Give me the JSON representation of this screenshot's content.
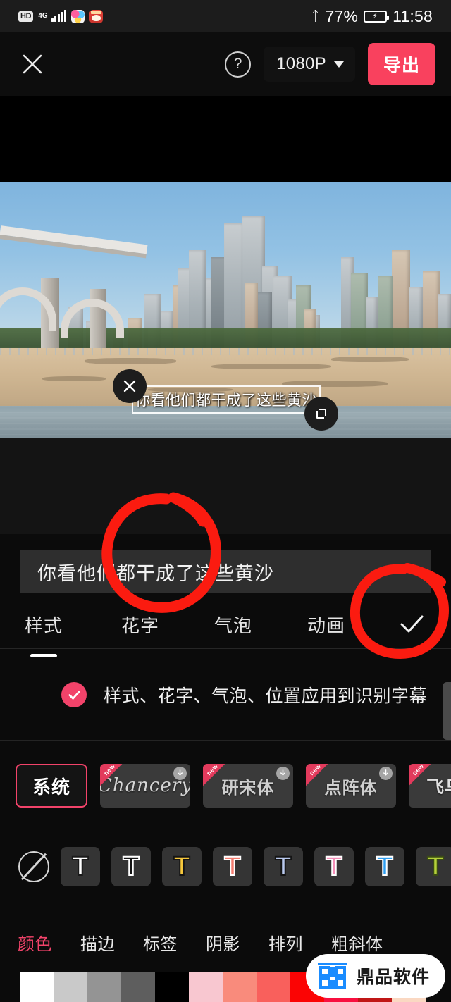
{
  "status_bar": {
    "hd_badge": "HD",
    "network": "4G",
    "bluetooth_icon": "bluetooth-icon",
    "battery_percent": "77%",
    "battery_icon": "battery-charging-icon",
    "time": "11:58",
    "app_icons": [
      "photos-app-icon",
      "red-app-icon"
    ]
  },
  "toolbar": {
    "close_icon": "close-icon",
    "help_icon": "help-question-icon",
    "resolution": "1080P",
    "resolution_caret": "chevron-down-icon",
    "export_label": "导出"
  },
  "preview": {
    "caption_text": "你看他们都干成了这些黄沙",
    "delete_icon": "close-icon",
    "resize_icon": "resize-handle-icon"
  },
  "editor": {
    "input_value": "你看他们都干成了这些黄沙",
    "tabs": [
      {
        "label": "样式",
        "active": true
      },
      {
        "label": "花字",
        "active": false
      },
      {
        "label": "气泡",
        "active": false
      },
      {
        "label": "动画",
        "active": false
      }
    ],
    "confirm_icon": "checkmark-icon",
    "apply": {
      "checked": true,
      "check_icon": "check-icon",
      "label": "样式、花字、气泡、位置应用到识别字幕",
      "accent_color": "#f2436a"
    },
    "fonts": [
      {
        "label": "系统",
        "selected": true,
        "new": false,
        "download": false,
        "style": "system"
      },
      {
        "label": "Chancery",
        "selected": false,
        "new": true,
        "download": true,
        "style": "script",
        "badge": "new"
      },
      {
        "label": "研宋体",
        "selected": false,
        "new": true,
        "download": true,
        "style": "serif",
        "badge": "new"
      },
      {
        "label": "点阵体",
        "selected": false,
        "new": true,
        "download": true,
        "style": "serif",
        "badge": "new"
      },
      {
        "label": "飞乌集",
        "selected": false,
        "new": true,
        "download": false,
        "style": "calli",
        "badge": "new"
      }
    ],
    "download_icon": "download-arrow-icon",
    "presets": {
      "none_icon": "no-style-icon",
      "items": [
        {
          "name": "white-t",
          "fill": "#ffffff",
          "stroke": "#1a1a1a"
        },
        {
          "name": "black-t",
          "fill": "#141414",
          "stroke": "#ffffff"
        },
        {
          "name": "yellow-t",
          "fill": "#f5c73c",
          "stroke": "#141414"
        },
        {
          "name": "red-t",
          "fill": "#f47b6e",
          "stroke": "#ffffff"
        },
        {
          "name": "lightblue-t",
          "fill": "#b9c9ee",
          "stroke": "#141414"
        },
        {
          "name": "pink-t",
          "fill": "#f48fb8",
          "stroke": "#ffffff"
        },
        {
          "name": "blue-t",
          "fill": "#2f9ef0",
          "stroke": "#ffffff"
        },
        {
          "name": "green-t",
          "fill": "#b5d13a",
          "stroke": "#3a4a16"
        }
      ]
    },
    "sub_tabs": [
      {
        "label": "颜色",
        "active": true
      },
      {
        "label": "描边",
        "active": false
      },
      {
        "label": "标签",
        "active": false
      },
      {
        "label": "阴影",
        "active": false
      },
      {
        "label": "排列",
        "active": false
      },
      {
        "label": "粗斜体",
        "active": false
      }
    ],
    "swatches": [
      "#ffffff",
      "#c9c9c9",
      "#949494",
      "#5e5e5e",
      "#000000",
      "#f8c7d0",
      "#f98b7c",
      "#f9605c",
      "#fb0404",
      "#f80f3f",
      "#c01616",
      "#fad8c2"
    ]
  },
  "annotations": {
    "circle_color": "#fb1b10",
    "circles": [
      "highlight-huazi-tab",
      "highlight-confirm-check"
    ]
  },
  "watermark": {
    "logo_name": "dingpin-logo-icon",
    "logo_color": "#1a8cff",
    "text": "鼎品软件"
  }
}
